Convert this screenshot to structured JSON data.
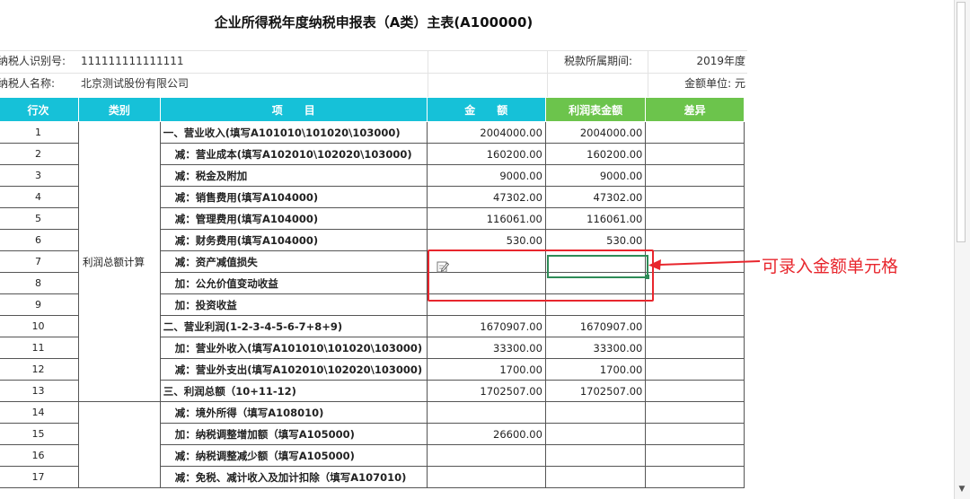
{
  "title": "企业所得税年度纳税申报表（A类）主表(A100000)",
  "info": {
    "taxpayer_id_label": "纳税人识别号:",
    "taxpayer_id": "111111111111111",
    "period_label": "税款所属期间:",
    "period": "2019年度",
    "taxpayer_name_label": "纳税人名称:",
    "taxpayer_name": "北京测试股份有限公司",
    "unit_label": "金额单位: 元"
  },
  "headers": {
    "row_no": "行次",
    "category": "类别",
    "item": "项　　目",
    "amount": "金　　额",
    "profit_amount": "利润表金额",
    "difference": "差异"
  },
  "categories": {
    "profit_total": "利润总额计算"
  },
  "rows": [
    {
      "no": "1",
      "item": "一、营业收入(填写A101010\\101020\\103000)",
      "amount": "2004000.00",
      "profit": "2004000.00",
      "diff": ""
    },
    {
      "no": "2",
      "item": "减：营业成本(填写A102010\\102020\\103000)",
      "amount": "160200.00",
      "profit": "160200.00",
      "diff": ""
    },
    {
      "no": "3",
      "item": "减：税金及附加",
      "amount": "9000.00",
      "profit": "9000.00",
      "diff": ""
    },
    {
      "no": "4",
      "item": "减：销售费用(填写A104000)",
      "amount": "47302.00",
      "profit": "47302.00",
      "diff": ""
    },
    {
      "no": "5",
      "item": "减：管理费用(填写A104000)",
      "amount": "116061.00",
      "profit": "116061.00",
      "diff": ""
    },
    {
      "no": "6",
      "item": "减：财务费用(填写A104000)",
      "amount": "530.00",
      "profit": "530.00",
      "diff": ""
    },
    {
      "no": "7",
      "item": "减：资产减值损失",
      "amount": "",
      "profit": "",
      "diff": ""
    },
    {
      "no": "8",
      "item": "加：公允价值变动收益",
      "amount": "",
      "profit": "",
      "diff": ""
    },
    {
      "no": "9",
      "item": "加：投资收益",
      "amount": "",
      "profit": "",
      "diff": ""
    },
    {
      "no": "10",
      "item": "二、营业利润(1-2-3-4-5-6-7+8+9)",
      "amount": "1670907.00",
      "profit": "1670907.00",
      "diff": ""
    },
    {
      "no": "11",
      "item": "加：营业外收入(填写A101010\\101020\\103000)",
      "amount": "33300.00",
      "profit": "33300.00",
      "diff": ""
    },
    {
      "no": "12",
      "item": "减：营业外支出(填写A102010\\102020\\103000)",
      "amount": "1700.00",
      "profit": "1700.00",
      "diff": ""
    },
    {
      "no": "13",
      "item": "三、利润总额（10+11-12)",
      "amount": "1702507.00",
      "profit": "1702507.00",
      "diff": ""
    },
    {
      "no": "14",
      "item": "减：境外所得（填写A108010)",
      "amount": "",
      "profit": "",
      "diff": ""
    },
    {
      "no": "15",
      "item": "加：纳税调整增加额（填写A105000)",
      "amount": "26600.00",
      "profit": "",
      "diff": ""
    },
    {
      "no": "16",
      "item": "减：纳税调整减少额（填写A105000)",
      "amount": "",
      "profit": "",
      "diff": ""
    },
    {
      "no": "17",
      "item": "减：免税、减计收入及加计扣除（填写A107010)",
      "amount": "",
      "profit": "",
      "diff": ""
    }
  ],
  "annotation": "可录入金额单元格",
  "colors": {
    "header_cyan": "#16c1d8",
    "header_green": "#6cc44c",
    "highlight_red": "#e8262d",
    "active_cell_green": "#2e8b57"
  },
  "icons": {
    "edit": "edit-icon",
    "scroll_down": "chevron-down-icon"
  }
}
